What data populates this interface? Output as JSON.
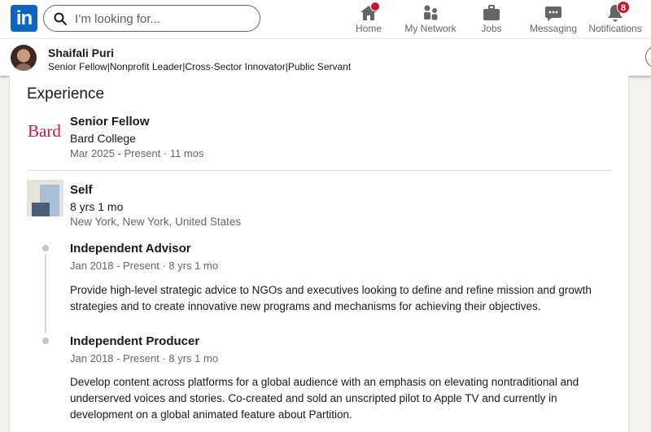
{
  "nav": {
    "logo_text": "in",
    "search": {
      "placeholder": "I’m looking for..."
    },
    "items": [
      {
        "label": "Home",
        "icon": "home-icon"
      },
      {
        "label": "My Network",
        "icon": "people-icon"
      },
      {
        "label": "Jobs",
        "icon": "briefcase-icon"
      },
      {
        "label": "Messaging",
        "icon": "chat-icon"
      },
      {
        "label": "Notifications",
        "icon": "bell-icon",
        "badge": "8"
      }
    ]
  },
  "profile": {
    "name": "Shaifali Puri",
    "headline": "Senior Fellow|Nonprofit Leader|Cross-Sector Innovator|Public Servant"
  },
  "experience": {
    "section_title": "Experience",
    "entries": [
      {
        "logo_text": "Bard",
        "title": "Senior Fellow",
        "organization": "Bard College",
        "dates": "Mar 2025 - Present · 11 mos"
      },
      {
        "title": "Self",
        "duration": "8 yrs 1 mo",
        "location": "New York, New York, United States",
        "roles": [
          {
            "title": "Independent Advisor",
            "dates": "Jan 2018 - Present · 8 yrs 1 mo",
            "description": "Provide high-level strategic advice to NGOs and executives looking to define and refine mission and growth strategies and to create innovative new programs and mechanisms for achieving their objectives."
          },
          {
            "title": "Independent Producer",
            "dates": "Jan 2018 - Present · 8 yrs 1 mo",
            "description": "Develop content across platforms for a global audience with an emphasis on elevating nontraditional and underserved voices and stories. Co-created and sold an unscripted pilot to Apple TV and currently in development on a global animated feature about Partition."
          }
        ]
      }
    ]
  },
  "colors": {
    "brand": "#0a66c2",
    "badge": "#cb112d",
    "bard": "#c01a3c"
  }
}
